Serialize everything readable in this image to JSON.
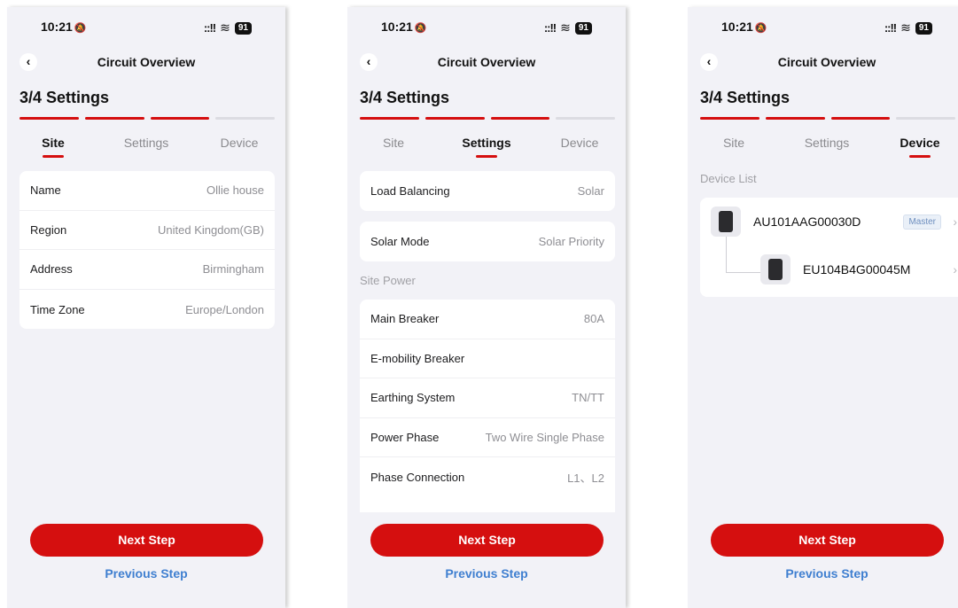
{
  "status": {
    "time": "10:21",
    "bell": "🔕",
    "signal": "::!!",
    "wifi": "≋",
    "battery": "91"
  },
  "nav": {
    "back": "‹",
    "title": "Circuit Overview"
  },
  "step_title": "3/4 Settings",
  "tabs": [
    "Site",
    "Settings",
    "Device"
  ],
  "colors": {
    "accent": "#d50f0f",
    "link": "#3f7fd0",
    "background": "#f2f2f7"
  },
  "screens": [
    {
      "active_tab": "Site",
      "rows": [
        {
          "label": "Name",
          "value": "Ollie house"
        },
        {
          "label": "Region",
          "value": "United Kingdom(GB)"
        },
        {
          "label": "Address",
          "value": "Birmingham"
        },
        {
          "label": "Time Zone",
          "value": "Europe/London"
        }
      ]
    },
    {
      "active_tab": "Settings",
      "load_balancing": {
        "label": "Load Balancing",
        "value": "Solar"
      },
      "solar_mode": {
        "label": "Solar Mode",
        "value": "Solar Priority"
      },
      "site_power_label": "Site Power",
      "site_power_rows": [
        {
          "label": "Main Breaker",
          "value": "80A"
        },
        {
          "label": "E-mobility Breaker",
          "value": ""
        },
        {
          "label": "Earthing System",
          "value": "TN/TT"
        },
        {
          "label": "Power Phase",
          "value": "Two Wire Single Phase"
        },
        {
          "label": "Phase Connection",
          "value": "L1、L2"
        }
      ]
    },
    {
      "active_tab": "Device",
      "device_list_label": "Device List",
      "devices": [
        {
          "name": "AU101AAG00030D",
          "badge": "Master",
          "chevron": "›",
          "icon": "charger-icon"
        },
        {
          "name": "EU104B4G00045M",
          "chevron": "›",
          "icon": "charger-icon"
        }
      ]
    }
  ],
  "buttons": {
    "next": "Next Step",
    "previous": "Previous Step"
  }
}
